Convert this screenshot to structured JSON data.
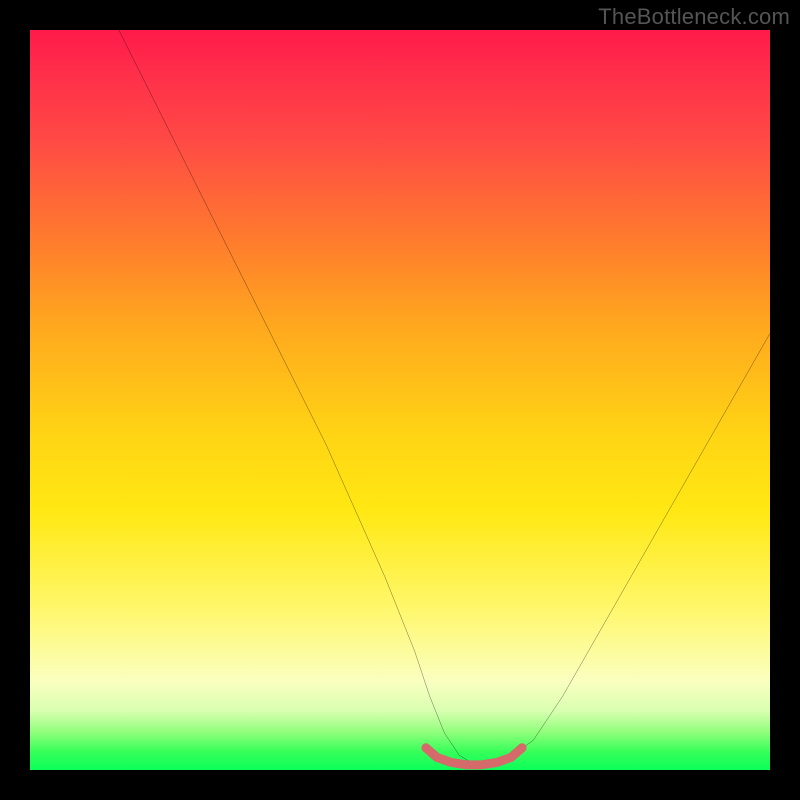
{
  "watermark": "TheBottleneck.com",
  "chart_data": {
    "type": "line",
    "title": "",
    "xlabel": "",
    "ylabel": "",
    "xlim": [
      0,
      100
    ],
    "ylim": [
      0,
      100
    ],
    "grid": false,
    "legend": false,
    "series": [
      {
        "name": "curve",
        "color": "#000000",
        "stroke_width": 2,
        "x": [
          12,
          16,
          20,
          24,
          28,
          32,
          36,
          40,
          44,
          48,
          52,
          54,
          56,
          58,
          60,
          62,
          64,
          68,
          72,
          76,
          80,
          84,
          88,
          92,
          96,
          100
        ],
        "y": [
          100,
          92,
          84,
          76,
          68,
          60,
          52,
          44,
          35,
          26,
          16,
          10,
          5,
          2,
          0.8,
          0.5,
          1.2,
          4,
          10,
          17,
          24,
          31,
          38,
          45,
          52,
          59
        ]
      },
      {
        "name": "valley-marker",
        "color": "#d46a6a",
        "stroke_width": 9,
        "cap": "round",
        "x": [
          53.5,
          55,
          57,
          59,
          61,
          63,
          65,
          66.5
        ],
        "y": [
          3.0,
          1.7,
          1.0,
          0.7,
          0.7,
          1.0,
          1.7,
          3.0
        ]
      }
    ],
    "background_gradient": {
      "direction": "top-to-bottom",
      "stops": [
        {
          "pos": 0.0,
          "color": "#ff1a4a"
        },
        {
          "pos": 0.15,
          "color": "#ff4a45"
        },
        {
          "pos": 0.4,
          "color": "#ffa81e"
        },
        {
          "pos": 0.65,
          "color": "#ffe813"
        },
        {
          "pos": 0.88,
          "color": "#faffc0"
        },
        {
          "pos": 0.95,
          "color": "#8dff7a"
        },
        {
          "pos": 1.0,
          "color": "#0bff59"
        }
      ]
    }
  }
}
